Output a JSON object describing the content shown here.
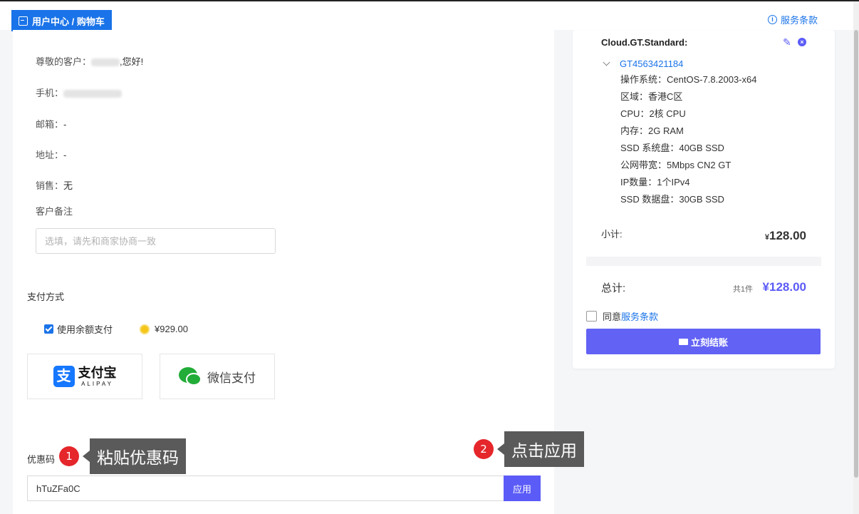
{
  "header": {
    "breadcrumb": "用户中心 / 购物车",
    "terms_link": "服务条款"
  },
  "customer": {
    "greeting_prefix": "尊敬的客户：",
    "greeting_suffix": ",您好!",
    "phone_label": "手机：",
    "email_label": "邮箱：",
    "email_value": "-",
    "address_label": "地址：",
    "address_value": "-",
    "sales_label": "销售：",
    "sales_value": "无",
    "remark_label": "客户备注",
    "remark_placeholder": "选填，请先和商家协商一致"
  },
  "payment": {
    "title": "支付方式",
    "balance_label": "使用余额支付",
    "balance_amount": "¥929.00",
    "alipay_cn": "支付宝",
    "alipay_en": "ALIPAY",
    "wechat": "微信支付"
  },
  "coupon": {
    "label": "优惠码",
    "value": "hTuZFa0C",
    "apply_label": "应用"
  },
  "annotations": [
    {
      "number": "1",
      "text": "粘贴优惠码"
    },
    {
      "number": "2",
      "text": "点击应用"
    }
  ],
  "cart": {
    "product_name": "Cloud.GT.Standard:",
    "instance_id": "GT4563421184",
    "specs": [
      "操作系统：CentOS-7.8.2003-x64",
      "区域：香港C区",
      "CPU：2核 CPU",
      "内存：2G RAM",
      "SSD 系统盘：40GB SSD",
      "公网带宽：5Mbps CN2 GT",
      "IP数量：1个IPv4",
      "SSD 数据盘：30GB SSD"
    ],
    "subtotal_label": "小计:",
    "subtotal_currency": "¥",
    "subtotal_value": "128.00",
    "total_label": "总计:",
    "quantity_text": "共1件",
    "total_value": "¥128.00",
    "agree_prefix": "同意",
    "agree_link": "服务条款",
    "checkout_label": "立刻结账"
  },
  "colors": {
    "accent": "#5b5bf7",
    "link": "#1a73e8",
    "badge": "#e5262b"
  }
}
